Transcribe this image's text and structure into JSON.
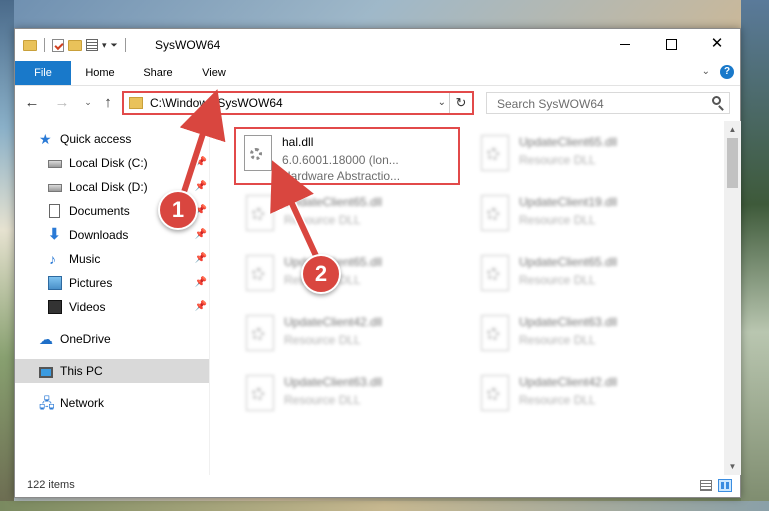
{
  "window": {
    "title": "SysWOW64"
  },
  "ribbon": {
    "tabs": [
      "File",
      "Home",
      "Share",
      "View"
    ],
    "expand_icon": "chevron-down-icon",
    "help_icon": "?"
  },
  "window_buttons": {
    "minimize": "minimize-icon",
    "maximize": "maximize-icon",
    "close": "✕"
  },
  "address": {
    "path": "C:\\Windows\\SysWOW64",
    "refresh_glyph": "↻",
    "dropdown_glyph": "⌄"
  },
  "search": {
    "placeholder": "Search SysWOW64"
  },
  "nav_glyphs": {
    "back": "←",
    "forward": "→",
    "recent": "⌄",
    "up": "↑"
  },
  "nav_pane": {
    "items": [
      {
        "label": "Quick access",
        "icon": "star-icon",
        "pinned": false
      },
      {
        "label": "Local Disk (C:)",
        "icon": "disk-icon",
        "pinned": true
      },
      {
        "label": "Local Disk (D:)",
        "icon": "disk-icon",
        "pinned": true
      },
      {
        "label": "Documents",
        "icon": "documents-icon",
        "pinned": true
      },
      {
        "label": "Downloads",
        "icon": "downloads-icon",
        "pinned": true
      },
      {
        "label": "Music",
        "icon": "music-icon",
        "pinned": true
      },
      {
        "label": "Pictures",
        "icon": "pictures-icon",
        "pinned": true
      },
      {
        "label": "Videos",
        "icon": "videos-icon",
        "pinned": true
      },
      {
        "label": "OneDrive",
        "icon": "onedrive-icon",
        "pinned": false
      },
      {
        "label": "This PC",
        "icon": "pc-icon",
        "pinned": false
      },
      {
        "label": "Network",
        "icon": "network-icon",
        "pinned": false
      }
    ],
    "pin_glyph": "📌"
  },
  "files": [
    {
      "name": "hal.dll",
      "line2": "6.0.6001.18000 (lon...",
      "line3": "Hardware Abstractio..."
    },
    {
      "name": "UpdateClient65.dll",
      "line2": "Resource DLL",
      "line3": ""
    },
    {
      "name": "UpdateClient65.dll",
      "line2": "Resource DLL",
      "line3": ""
    },
    {
      "name": "UpdateClient19.dll",
      "line2": "Resource DLL",
      "line3": ""
    },
    {
      "name": "UpdateClient65.dll",
      "line2": "Resource DLL",
      "line3": ""
    },
    {
      "name": "UpdateClient65.dll",
      "line2": "Resource DLL",
      "line3": ""
    },
    {
      "name": "UpdateClient42.dll",
      "line2": "Resource DLL",
      "line3": ""
    },
    {
      "name": "UpdateClient63.dll",
      "line2": "Resource DLL",
      "line3": ""
    },
    {
      "name": "UpdateClient63.dll",
      "line2": "Resource DLL",
      "line3": ""
    },
    {
      "name": "UpdateClient42.dll",
      "line2": "Resource DLL",
      "line3": ""
    }
  ],
  "status": {
    "item_count": "122 items"
  },
  "annotations": {
    "badge1": "1",
    "badge2": "2",
    "color": "#d9463f"
  },
  "colors": {
    "accent": "#1979ca",
    "highlight_border": "#e24a4a"
  }
}
